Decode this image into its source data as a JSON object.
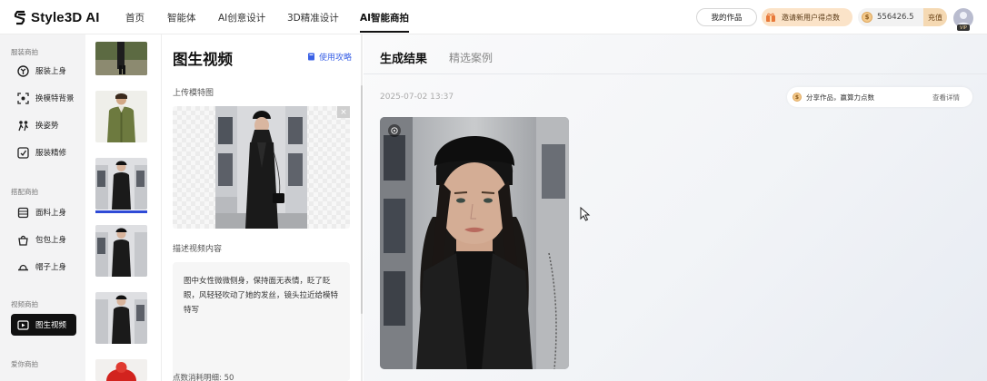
{
  "header": {
    "logo_text": "Style3D AI",
    "nav": [
      "首页",
      "智能体",
      "AI创意设计",
      "3D精准设计",
      "AI智能商拍"
    ],
    "active_nav": "AI智能商拍",
    "my_works": "我的作品",
    "invite": "邀请新用户得点数",
    "credits": "556426.5",
    "recharge": "充值",
    "vip": "VIP"
  },
  "sidebar": {
    "sections": [
      {
        "title": "服装商拍",
        "items": [
          "服装上身",
          "换模特背景",
          "换姿势",
          "服装精修"
        ]
      },
      {
        "title": "搭配商拍",
        "items": [
          "面料上身",
          "包包上身",
          "帽子上身"
        ]
      },
      {
        "title": "视频商拍",
        "items": [
          "图生视频"
        ]
      },
      {
        "title": "爱你商拍",
        "items": []
      }
    ],
    "active_item": "图生视频"
  },
  "panel": {
    "title": "图生视频",
    "guide": "使用攻略",
    "upload_label": "上传模特图",
    "desc_label": "描述视频内容",
    "desc_text": "图中女性微微侧身，保持面无表情，眨了眨眼，风轻轻吹动了她的发丝，镜头拉近给模特特写",
    "bottom_text": "点数消耗明细: 50",
    "close_icon": "×"
  },
  "main": {
    "tabs": [
      "生成结果",
      "精选案例"
    ],
    "active_tab": "生成结果",
    "timestamp": "2025-07-02 13:37",
    "share_text": "分享作品，赢算力点数",
    "share_view": "查看详情"
  },
  "colors": {
    "accent": "#3b62e6",
    "active_bg": "#111111",
    "invite_bg": "#fbe3c8",
    "selection": "#2f4bd6"
  }
}
